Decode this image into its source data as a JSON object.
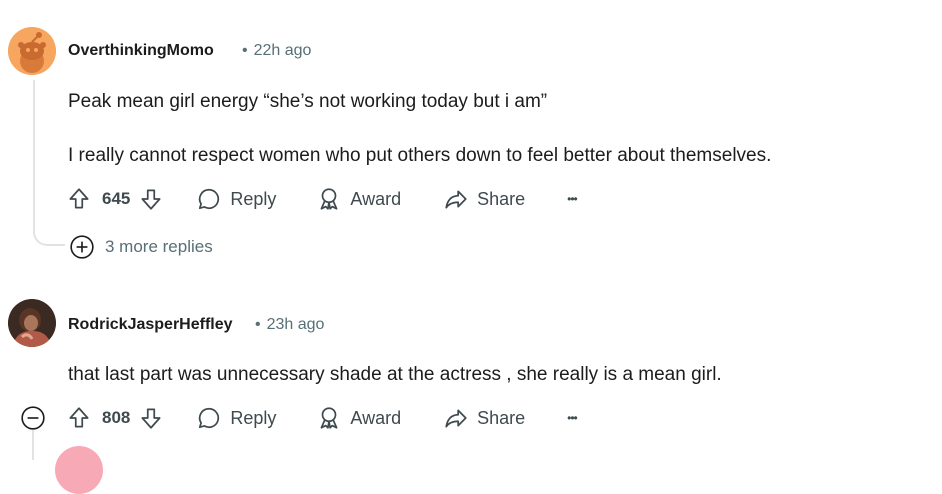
{
  "comments": [
    {
      "author": "OverthinkingMomo",
      "separator": "•",
      "time": "22h ago",
      "paragraphs": [
        "Peak mean girl energy “she’s not working today but i am”",
        "I really cannot respect women who put others down to feel better about themselves."
      ],
      "score": "645",
      "reply_label": "Reply",
      "award_label": "Award",
      "share_label": "Share",
      "more_label": "•••",
      "more_replies": "3 more replies"
    },
    {
      "author": "RodrickJasperHeffley",
      "separator": "•",
      "time": "23h ago",
      "paragraphs": [
        "that last part was unnecessary shade at the actress , she really is a mean girl."
      ],
      "score": "808",
      "reply_label": "Reply",
      "award_label": "Award",
      "share_label": "Share",
      "more_label": "•••"
    }
  ],
  "colors": {
    "avatar1": "#f6a65e",
    "avatar2": "#6b4a3a",
    "avatar3": "#f7a9b6",
    "meta": "#576f76",
    "thread_line": "#e0e3e5"
  }
}
